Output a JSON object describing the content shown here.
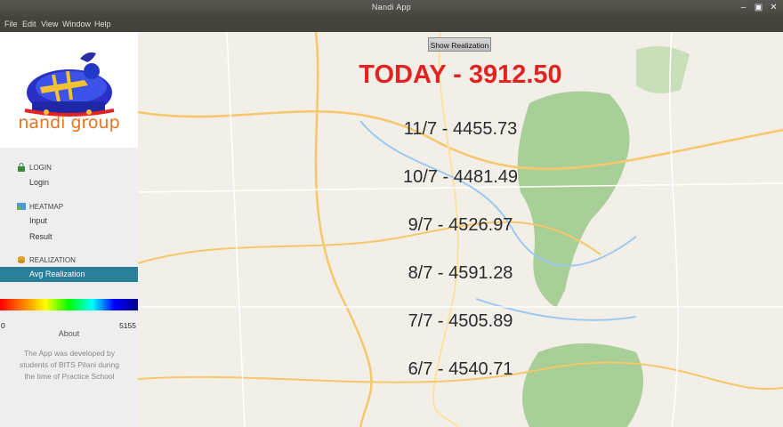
{
  "window": {
    "title": "Nandi App"
  },
  "menu": [
    "File",
    "Edit",
    "View",
    "Window",
    "Help"
  ],
  "logo": {
    "text": "nandi group"
  },
  "nav": {
    "login_head": "LOGIN",
    "login_item": "Login",
    "heatmap_head": "HEATMAP",
    "input_item": "Input",
    "result_item": "Result",
    "realization_head": "REALIZATION",
    "avg_item": "Avg Realization"
  },
  "legend": {
    "min": "0",
    "max": "5155"
  },
  "about": {
    "title": "About",
    "text": "The App was developed by students of BITS Pilani during the time of Practice School"
  },
  "main": {
    "button_label": "Show Realization",
    "today": "TODAY - 3912.50",
    "realizations": [
      "11/7 - 4455.73",
      "10/7 - 4481.49",
      "9/7 - 4526.97",
      "8/7 - 4591.28",
      "7/7 - 4505.89",
      "6/7 - 4540.71"
    ]
  },
  "colors": {
    "accent": "#2a7f99",
    "today": "#e32222",
    "map_bg": "#f2efe9",
    "forest": "#9cc98a"
  }
}
